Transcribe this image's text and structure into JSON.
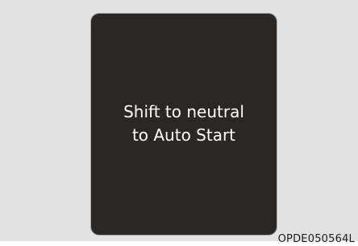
{
  "display": {
    "message_lines": [
      "Shift to neutral",
      "to Auto Start"
    ]
  },
  "figure": {
    "code": "OPDE050564L"
  }
}
